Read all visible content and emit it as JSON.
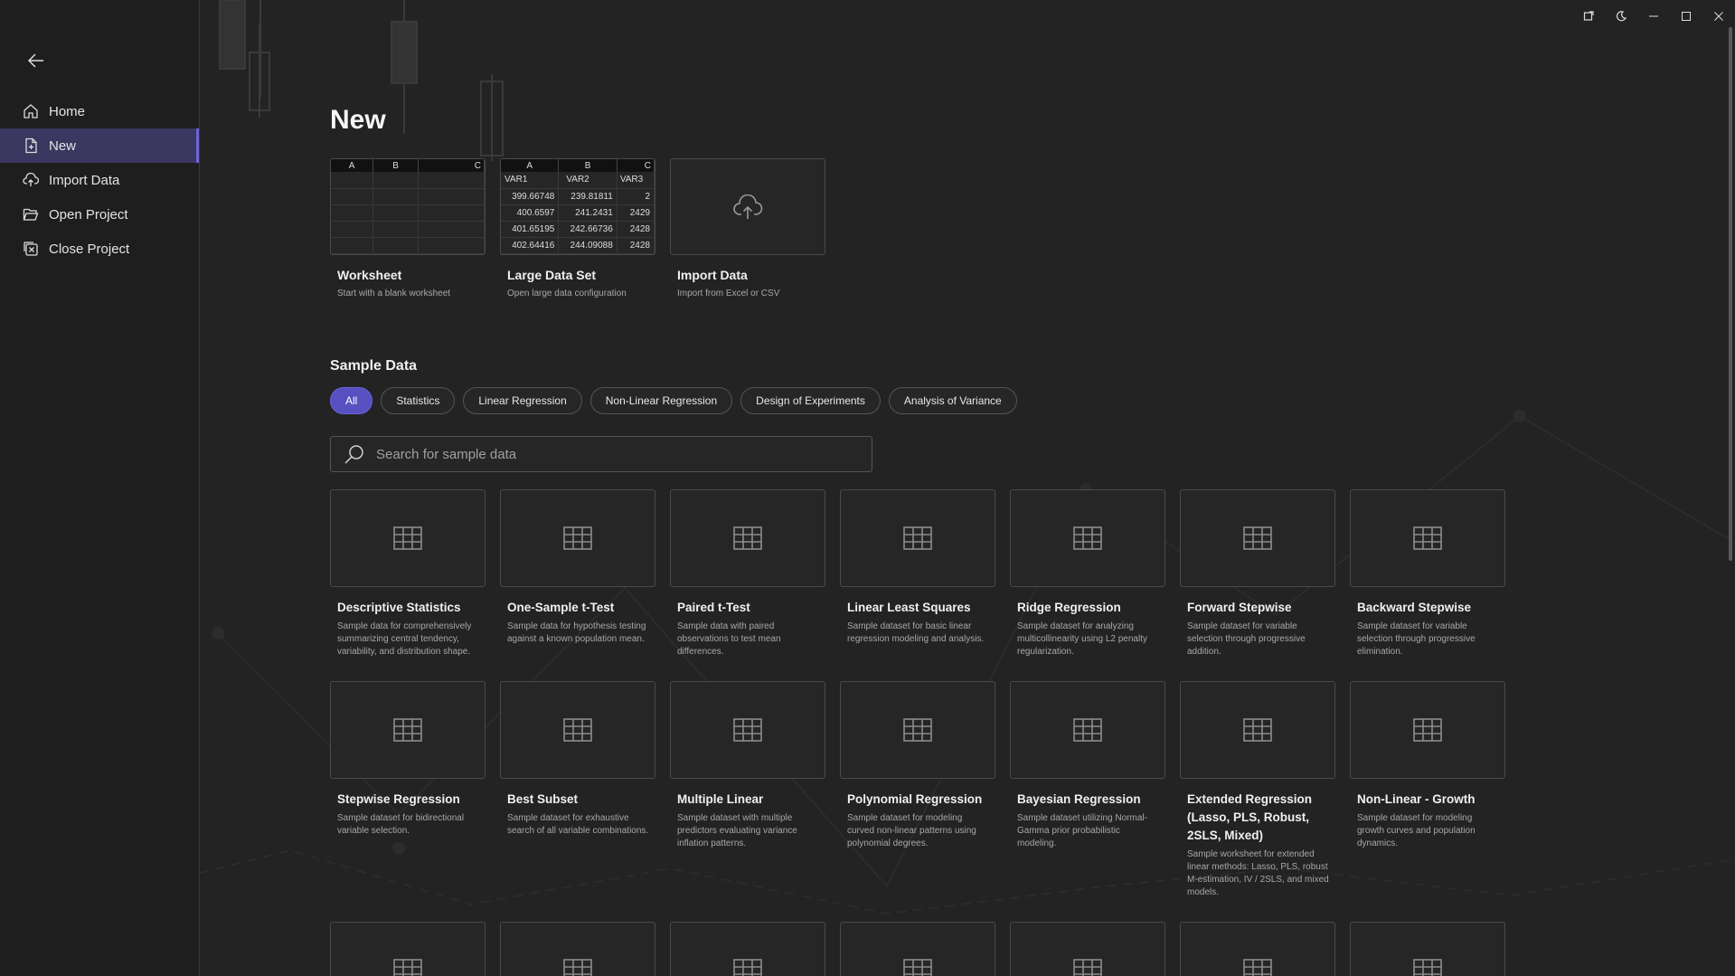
{
  "sidebar": {
    "items": [
      {
        "label": "Home",
        "icon": "home-icon"
      },
      {
        "label": "New",
        "icon": "new-document-icon",
        "active": true
      },
      {
        "label": "Import Data",
        "icon": "import-cloud-icon"
      },
      {
        "label": "Open Project",
        "icon": "folder-open-icon"
      },
      {
        "label": "Close Project",
        "icon": "close-project-icon"
      }
    ]
  },
  "window_controls": [
    "refresh-icon",
    "dark-mode-icon",
    "minimize-icon",
    "maximize-icon",
    "close-icon"
  ],
  "page_title": "New",
  "new_cards": [
    {
      "title": "Worksheet",
      "desc": "Start with a blank worksheet"
    },
    {
      "title": "Large Data Set",
      "desc": "Open large data configuration"
    },
    {
      "title": "Import Data",
      "desc": "Import from Excel or CSV"
    }
  ],
  "worksheet_preview": {
    "columns": [
      "A",
      "B",
      "C"
    ]
  },
  "large_preview": {
    "columns": [
      "A",
      "B",
      "C"
    ],
    "rows": [
      [
        "VAR1",
        "VAR2",
        "VAR3"
      ],
      [
        "399.66748",
        "239.81811",
        "2"
      ],
      [
        "400.6597",
        "241.2431",
        "2429"
      ],
      [
        "401.65195",
        "242.66736",
        "2428"
      ],
      [
        "402.64416",
        "244.09088",
        "2428"
      ]
    ]
  },
  "sample_section_title": "Sample Data",
  "filters": [
    "All",
    "Statistics",
    "Linear Regression",
    "Non-Linear Regression",
    "Design of Experiments",
    "Analysis of Variance"
  ],
  "search": {
    "placeholder": "Search for sample data"
  },
  "samples": [
    {
      "title": "Descriptive Statistics",
      "desc": "Sample data for comprehensively summarizing central tendency, variability, and distribution shape."
    },
    {
      "title": "One-Sample t-Test",
      "desc": "Sample data for hypothesis testing against a known population mean."
    },
    {
      "title": "Paired t-Test",
      "desc": "Sample data with paired observations to test mean differences."
    },
    {
      "title": "Linear Least Squares",
      "desc": "Sample dataset for basic linear regression modeling and analysis."
    },
    {
      "title": "Ridge Regression",
      "desc": "Sample dataset for analyzing multicollinearity using L2 penalty regularization."
    },
    {
      "title": "Forward Stepwise",
      "desc": "Sample dataset for variable selection through progressive addition."
    },
    {
      "title": "Backward Stepwise",
      "desc": "Sample dataset for variable selection through progressive elimination."
    },
    {
      "title": "Stepwise Regression",
      "desc": "Sample dataset for bidirectional variable selection."
    },
    {
      "title": "Best Subset",
      "desc": "Sample dataset for exhaustive search of all variable combinations."
    },
    {
      "title": "Multiple Linear",
      "desc": "Sample dataset with multiple predictors evaluating variance inflation patterns."
    },
    {
      "title": "Polynomial Regression",
      "desc": "Sample dataset for modeling curved non-linear patterns using polynomial degrees."
    },
    {
      "title": "Bayesian Regression",
      "desc": "Sample dataset utilizing Normal-Gamma prior probabilistic modeling."
    },
    {
      "title": "Extended Regression (Lasso, PLS, Robust, 2SLS, Mixed)",
      "desc": "Sample worksheet for extended linear methods: Lasso, PLS, robust M-estimation, IV / 2SLS, and mixed models."
    },
    {
      "title": "Non-Linear - Growth",
      "desc": "Sample dataset for modeling growth curves and population dynamics."
    }
  ],
  "colors": {
    "accent": "#6b64d8",
    "active_nav": "#3a3760",
    "background": "#232323",
    "sidebar": "#1e1e1e"
  }
}
